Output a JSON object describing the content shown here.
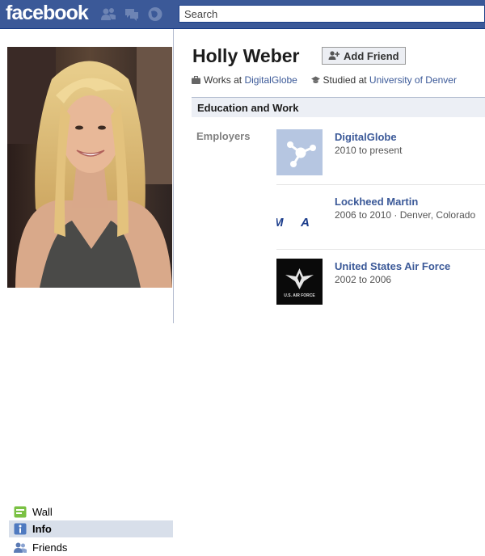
{
  "header": {
    "logo": "facebook",
    "search_placeholder": "Search",
    "jewels": [
      "friend-requests-icon",
      "messages-icon",
      "notifications-icon"
    ]
  },
  "profile": {
    "name": "Holly Weber",
    "add_friend_label": "Add Friend",
    "works_prefix": "Works at",
    "works_at": "DigitalGlobe",
    "studied_prefix": "Studied at",
    "studied_at": "University of Denver"
  },
  "nav": {
    "items": [
      {
        "label": "Wall",
        "icon": "wall-icon",
        "active": false
      },
      {
        "label": "Info",
        "icon": "info-icon",
        "active": true
      },
      {
        "label": "Friends",
        "icon": "friends-icon",
        "active": false
      }
    ]
  },
  "education_work": {
    "section_title": "Education and Work",
    "employers_label": "Employers",
    "employers": [
      {
        "name": "DigitalGlobe",
        "dates": "2010 to present",
        "logo": "digitalglobe-logo"
      },
      {
        "name": "Lockheed Martin",
        "dates": "2006 to 2010 · Denver, Colorado",
        "logo_text": "M A",
        "logo": "lockheed-martin-logo"
      },
      {
        "name": "United States Air Force",
        "dates": "2002 to 2006",
        "logo_text": "U.S. AIR FORCE",
        "logo": "us-air-force-logo"
      }
    ]
  },
  "colors": {
    "brand_blue": "#3b5998",
    "link_blue": "#3b5998",
    "active_nav_bg": "#d8dfea",
    "section_bg": "#eceff5"
  }
}
